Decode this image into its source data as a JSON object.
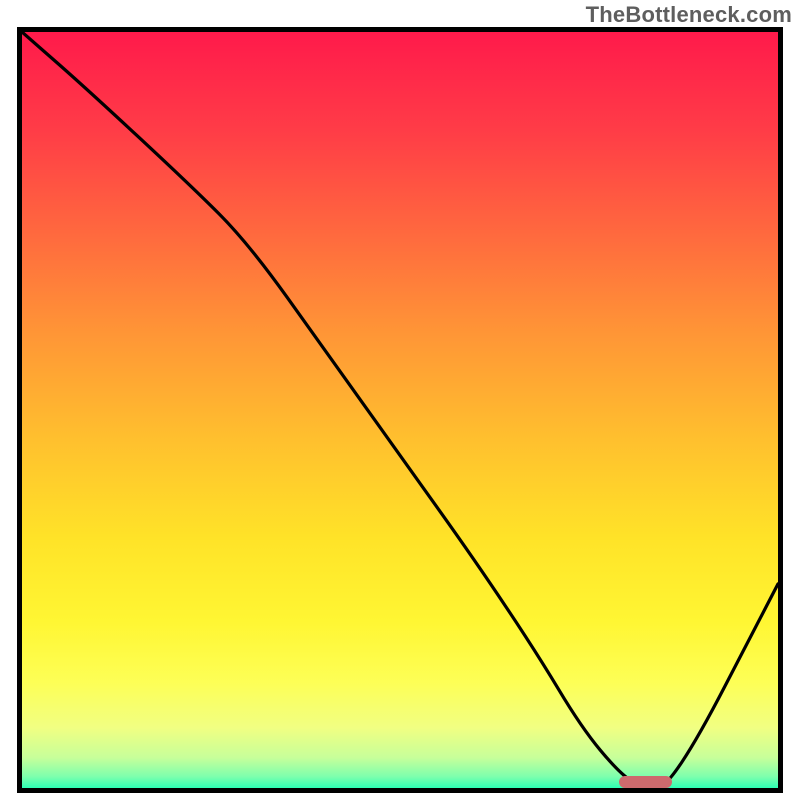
{
  "watermark": "TheBottleneck.com",
  "colors": {
    "border": "#000000",
    "curve": "#000000",
    "marker": "#cd6a6d",
    "gradient_stops": [
      {
        "offset": 0.0,
        "color": "#ff1a4b"
      },
      {
        "offset": 0.13,
        "color": "#ff3c47"
      },
      {
        "offset": 0.27,
        "color": "#ff6a3e"
      },
      {
        "offset": 0.4,
        "color": "#ff9636"
      },
      {
        "offset": 0.54,
        "color": "#ffc02e"
      },
      {
        "offset": 0.67,
        "color": "#ffe328"
      },
      {
        "offset": 0.78,
        "color": "#fff633"
      },
      {
        "offset": 0.86,
        "color": "#fdff56"
      },
      {
        "offset": 0.92,
        "color": "#f1ff82"
      },
      {
        "offset": 0.96,
        "color": "#c7ff9a"
      },
      {
        "offset": 0.985,
        "color": "#7dffad"
      },
      {
        "offset": 1.0,
        "color": "#2dffb4"
      }
    ]
  },
  "chart_data": {
    "type": "line",
    "title": "",
    "xlabel": "",
    "ylabel": "",
    "xlim": [
      0,
      100
    ],
    "ylim": [
      0,
      100
    ],
    "series": [
      {
        "name": "bottleneck-curve",
        "x": [
          0,
          8,
          22,
          30,
          40,
          50,
          60,
          68,
          74,
          79,
          82,
          86,
          100
        ],
        "values": [
          100,
          93,
          80,
          72,
          58,
          44,
          30,
          18,
          8,
          2,
          0,
          0,
          27
        ]
      }
    ],
    "marker": {
      "x_start": 79,
      "x_end": 86,
      "y": 0
    }
  }
}
